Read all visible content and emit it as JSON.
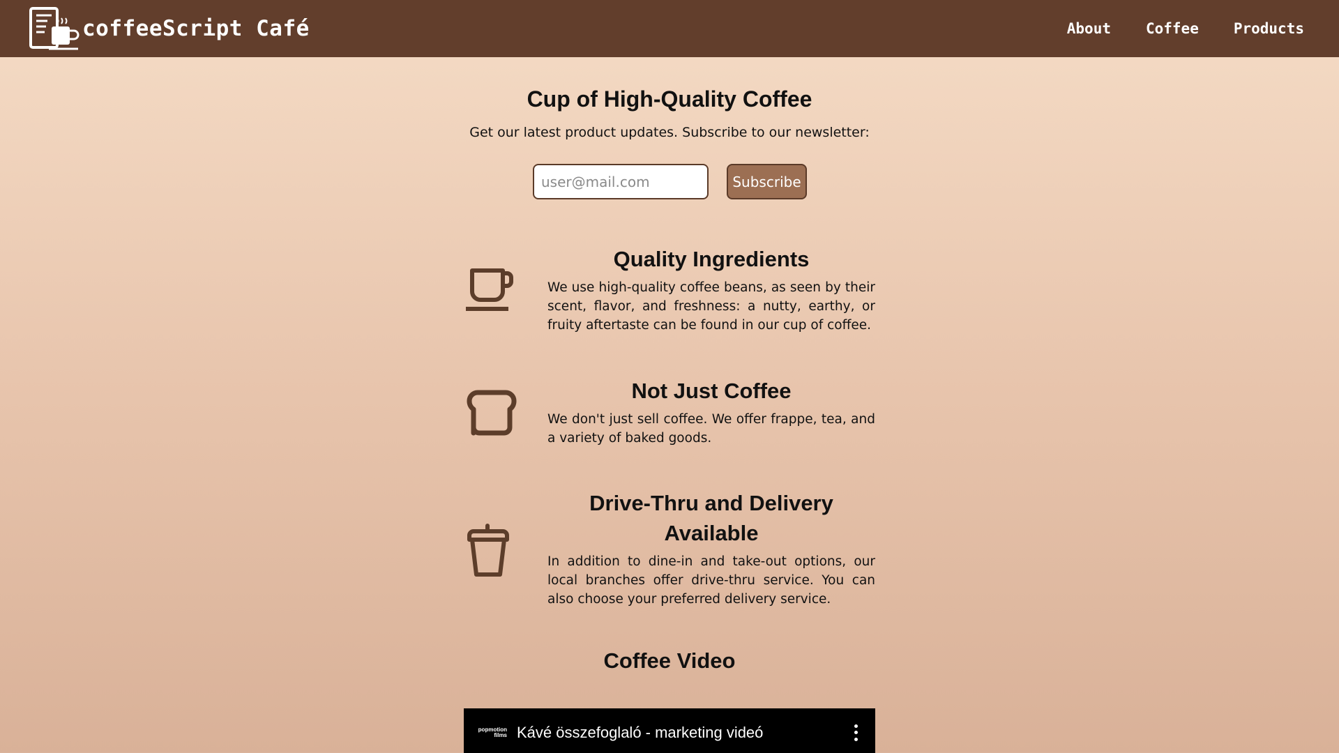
{
  "header": {
    "brand_name": "coffeeScript Café",
    "nav": [
      "About",
      "Coffee",
      "Products"
    ]
  },
  "hero": {
    "title": "Cup of High-Quality Coffee",
    "subtitle": "Get our latest product updates. Subscribe to our newsletter:",
    "email_placeholder": "user@mail.com",
    "subscribe_label": "Subscribe"
  },
  "features": [
    {
      "icon": "coffee-cup-icon",
      "title": "Quality Ingredients",
      "text": "We use high-quality coffee beans, as seen by their scent, flavor, and freshness: a nutty, earthy, or fruity aftertaste can be found in our cup of coffee."
    },
    {
      "icon": "bread-icon",
      "title": "Not Just Coffee",
      "text": "We don't just sell coffee. We offer frappe, tea, and a variety of baked goods."
    },
    {
      "icon": "takeaway-cup-icon",
      "title": "Drive-Thru and Delivery Available",
      "text": "In addition to dine-in and take-out options, our local branches offer drive-thru service. You can also choose your preferred delivery service."
    }
  ],
  "video": {
    "section_title": "Coffee Video",
    "channel": "popmotion films",
    "title": "Kávé összefoglaló - marketing videó"
  },
  "colors": {
    "navbar": "#623e2c",
    "icon": "#5c3d2a",
    "button": "#9c6f53"
  }
}
